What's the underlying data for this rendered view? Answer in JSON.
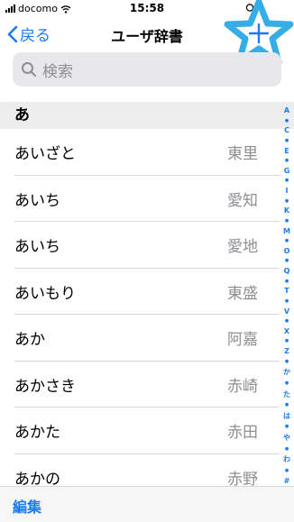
{
  "status": {
    "carrier": "docomo",
    "time": "15:58"
  },
  "nav": {
    "back_label": "戻る",
    "title": "ユーザ辞書"
  },
  "search": {
    "placeholder": "検索"
  },
  "section": {
    "header": "あ"
  },
  "entries": [
    {
      "reading": "あいざと",
      "word": "東里"
    },
    {
      "reading": "あいち",
      "word": "愛知"
    },
    {
      "reading": "あいち",
      "word": "愛地"
    },
    {
      "reading": "あいもり",
      "word": "東盛"
    },
    {
      "reading": "あか",
      "word": "阿嘉"
    },
    {
      "reading": "あかさき",
      "word": "赤崎"
    },
    {
      "reading": "あかた",
      "word": "赤田"
    },
    {
      "reading": "あかの",
      "word": "赤野"
    }
  ],
  "index": [
    "A",
    "●",
    "C",
    "●",
    "E",
    "●",
    "G",
    "●",
    "I",
    "●",
    "K",
    "●",
    "M",
    "●",
    "O",
    "●",
    "Q",
    "●",
    "T",
    "●",
    "V",
    "●",
    "X",
    "●",
    "Z",
    "●",
    "か",
    "●",
    "た",
    "●",
    "は",
    "●",
    "や",
    "●",
    "わ",
    "●",
    "#"
  ],
  "toolbar": {
    "edit_label": "編集"
  },
  "colors": {
    "accent": "#1a7cf0",
    "highlight_star": "#35aee8"
  }
}
